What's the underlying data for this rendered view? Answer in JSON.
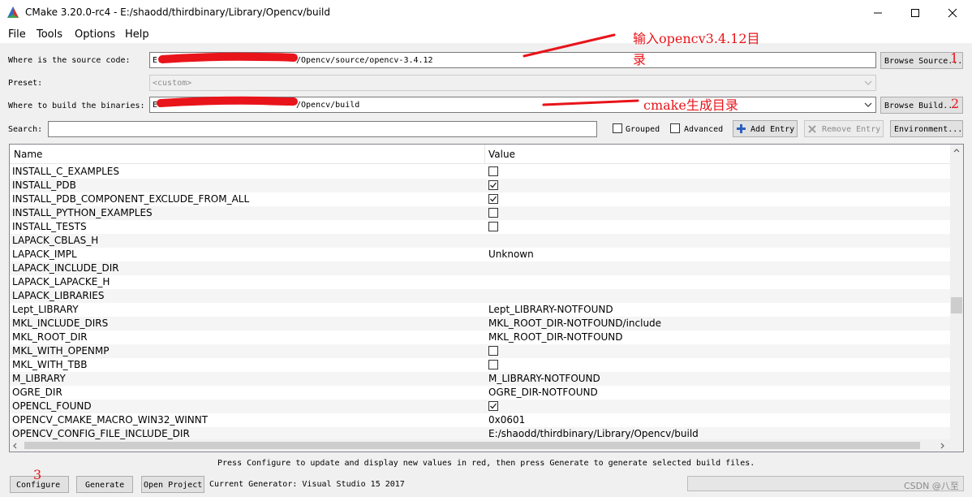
{
  "window": {
    "title": "CMake 3.20.0-rc4 - E:/shaodd/thirdbinary/Library/Opencv/build"
  },
  "menu": [
    "File",
    "Tools",
    "Options",
    "Help"
  ],
  "source": {
    "label": "Where is the source code:",
    "value_prefix": "E:/",
    "value_suffix": "/Opencv/source/opencv-3.4.12",
    "button": "Browse Source..."
  },
  "preset": {
    "label": "Preset:",
    "value": "<custom>"
  },
  "build": {
    "label": "Where to build the binaries:",
    "value_prefix": "E:",
    "value_suffix": "/Opencv/build",
    "button": "Browse Build..."
  },
  "search": {
    "label": "Search:",
    "value": ""
  },
  "toolbar": {
    "grouped_label": "Grouped",
    "grouped_checked": false,
    "advanced_label": "Advanced",
    "advanced_checked": false,
    "add_entry": "Add Entry",
    "remove_entry": "Remove Entry",
    "environment": "Environment..."
  },
  "table": {
    "headers": [
      "Name",
      "Value"
    ],
    "rows": [
      {
        "name": "INSTALL_C_EXAMPLES",
        "type": "bool",
        "checked": false
      },
      {
        "name": "INSTALL_PDB",
        "type": "bool",
        "checked": true
      },
      {
        "name": "INSTALL_PDB_COMPONENT_EXCLUDE_FROM_ALL",
        "type": "bool",
        "checked": true
      },
      {
        "name": "INSTALL_PYTHON_EXAMPLES",
        "type": "bool",
        "checked": false
      },
      {
        "name": "INSTALL_TESTS",
        "type": "bool",
        "checked": false
      },
      {
        "name": "LAPACK_CBLAS_H",
        "type": "text",
        "value": ""
      },
      {
        "name": "LAPACK_IMPL",
        "type": "text",
        "value": "Unknown"
      },
      {
        "name": "LAPACK_INCLUDE_DIR",
        "type": "text",
        "value": ""
      },
      {
        "name": "LAPACK_LAPACKE_H",
        "type": "text",
        "value": ""
      },
      {
        "name": "LAPACK_LIBRARIES",
        "type": "text",
        "value": ""
      },
      {
        "name": "Lept_LIBRARY",
        "type": "text",
        "value": "Lept_LIBRARY-NOTFOUND"
      },
      {
        "name": "MKL_INCLUDE_DIRS",
        "type": "text",
        "value": "MKL_ROOT_DIR-NOTFOUND/include"
      },
      {
        "name": "MKL_ROOT_DIR",
        "type": "text",
        "value": "MKL_ROOT_DIR-NOTFOUND"
      },
      {
        "name": "MKL_WITH_OPENMP",
        "type": "bool",
        "checked": false
      },
      {
        "name": "MKL_WITH_TBB",
        "type": "bool",
        "checked": false
      },
      {
        "name": "M_LIBRARY",
        "type": "text",
        "value": "M_LIBRARY-NOTFOUND"
      },
      {
        "name": "OGRE_DIR",
        "type": "text",
        "value": "OGRE_DIR-NOTFOUND"
      },
      {
        "name": "OPENCL_FOUND",
        "type": "bool",
        "checked": true
      },
      {
        "name": "OPENCV_CMAKE_MACRO_WIN32_WINNT",
        "type": "text",
        "value": "0x0601"
      },
      {
        "name": "OPENCV_CONFIG_FILE_INCLUDE_DIR",
        "type": "text",
        "value": "E:/shaodd/thirdbinary/Library/Opencv/build"
      }
    ]
  },
  "status": {
    "message": "Press Configure to update and display new values in red, then press Generate to generate selected build files.",
    "generator": "Current Generator: Visual Studio 15 2017"
  },
  "buttons": {
    "configure": "Configure",
    "generate": "Generate",
    "open_project": "Open Project"
  },
  "annotations": {
    "note_source_line1": "输入opencv3.4.12目",
    "note_source_line2": "录",
    "note_build": "cmake生成目录",
    "num_1": "1",
    "num_2": "2",
    "num_3": "3"
  },
  "watermark": "CSDN @八至",
  "colors": {
    "annotation_red": "#e8141a",
    "accent_blue": "#0078d7"
  },
  "icons": {
    "app": "cmake-triangle-icon",
    "add": "plus-icon",
    "remove": "x-icon"
  }
}
